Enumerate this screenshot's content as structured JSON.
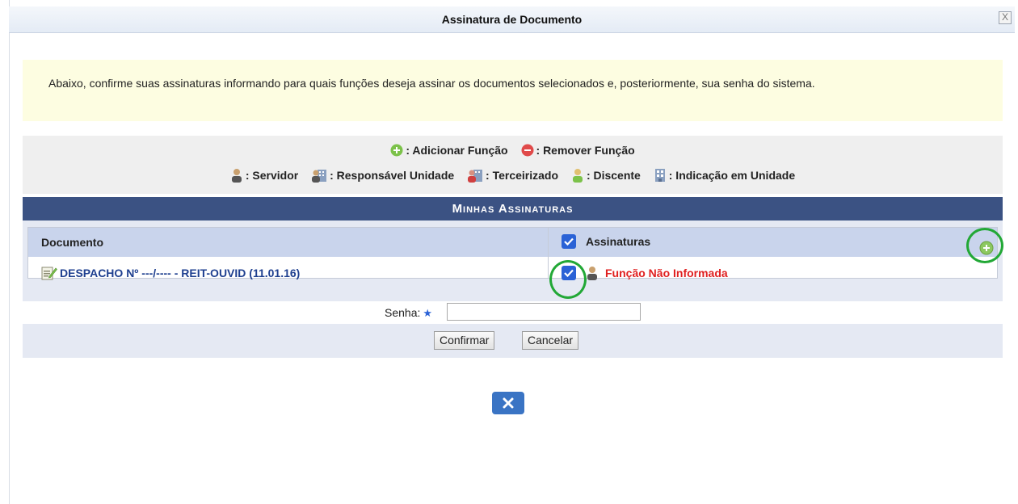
{
  "dialog": {
    "title": "Assinatura de Documento",
    "close_symbol": "X"
  },
  "info_text": "Abaixo, confirme suas assinaturas informando para quais funções deseja assinar os documentos selecionados e, posteriormente, sua senha do sistema.",
  "legend": {
    "row1": [
      {
        "icon": "add-circle-icon",
        "label": ": Adicionar Função"
      },
      {
        "icon": "remove-circle-icon",
        "label": ": Remover Função"
      }
    ],
    "row2": [
      {
        "icon": "servidor-person-icon",
        "label": ": Servidor"
      },
      {
        "icon": "responsavel-unidade-icon",
        "label": ": Responsável Unidade"
      },
      {
        "icon": "terceirizado-icon",
        "label": ": Terceirizado"
      },
      {
        "icon": "discente-person-icon",
        "label": ": Discente"
      },
      {
        "icon": "indicacao-unidade-icon",
        "label": ": Indicação em Unidade"
      }
    ]
  },
  "section_title": "Minhas Assinaturas",
  "table": {
    "col_documento": "Documento",
    "col_assinaturas": "Assinaturas",
    "rows": [
      {
        "documento": "DESPACHO Nº ---/---- - REIT-OUVID (11.01.16)",
        "funcao": "Função Não Informada",
        "checked": true
      }
    ]
  },
  "senha": {
    "label": "Senha:",
    "required_mark": "★",
    "value": ""
  },
  "buttons": {
    "confirm": "Confirmar",
    "cancel": "Cancelar"
  },
  "colors": {
    "header_bar": "#3b5283",
    "highlight": "#22a836",
    "error": "#e02020",
    "link": "#1e3f8f"
  }
}
